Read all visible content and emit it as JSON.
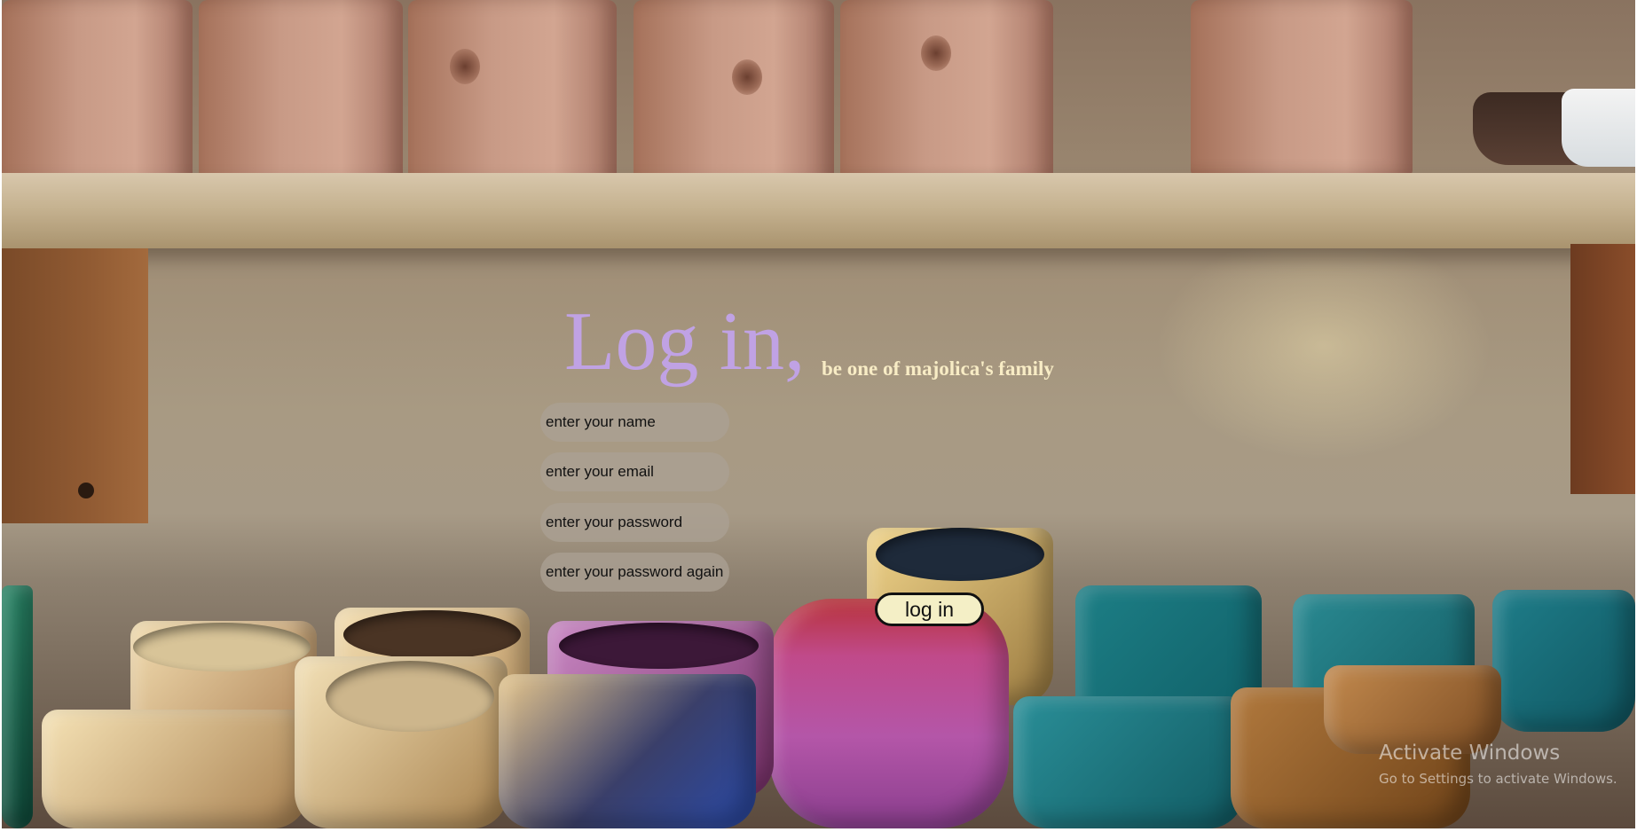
{
  "watermark": {
    "title": "Activate Windows",
    "subtitle": "Go to Settings to activate Windows."
  },
  "login": {
    "title": "Log in,",
    "subtitle": "be one of majolica's family",
    "fields": {
      "name_placeholder": "enter your name",
      "email_placeholder": "enter your email",
      "password_placeholder": "enter your password",
      "password_again_placeholder": "enter your password again"
    },
    "button_label": "log in"
  },
  "colors": {
    "title": "#c0a2e4",
    "subtitle": "#f8ecc5",
    "button_background": "#f4efc6",
    "field_background": "#aaa094"
  }
}
